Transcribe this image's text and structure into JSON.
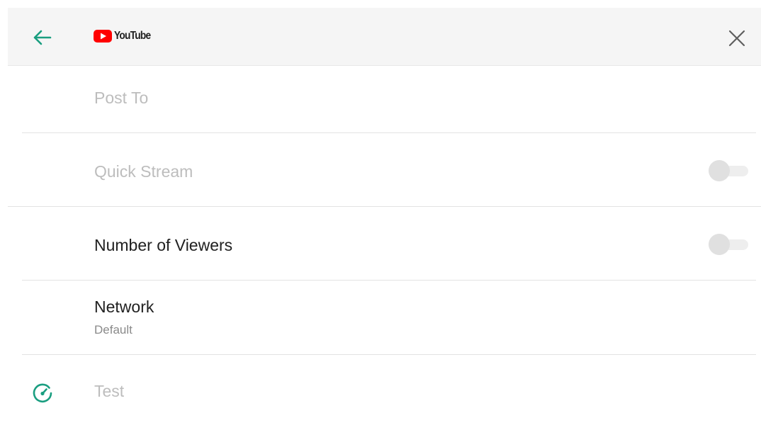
{
  "header": {
    "brand_label": "YouTube",
    "back_icon": "arrow-left-icon",
    "close_icon": "close-icon",
    "accent_color": "#1a9e80",
    "brand_color": "#ff0000"
  },
  "settings": {
    "post_to": {
      "label": "Post To",
      "enabled": false
    },
    "quick_stream": {
      "label": "Quick Stream",
      "enabled": false,
      "toggle_on": false
    },
    "number_of_viewers": {
      "label": "Number of Viewers",
      "enabled": true,
      "toggle_on": false
    },
    "network": {
      "label": "Network",
      "value": "Default"
    },
    "test": {
      "label": "Test",
      "enabled": false,
      "icon": "speedometer-icon"
    }
  }
}
